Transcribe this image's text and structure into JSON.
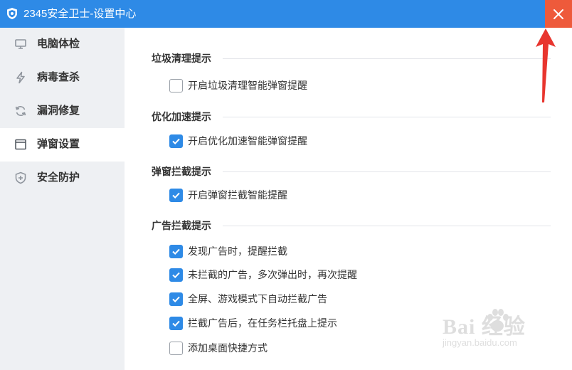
{
  "window": {
    "title": "2345安全卫士-设置中心",
    "close_label": "×"
  },
  "sidebar": {
    "items": [
      {
        "label": "电脑体检",
        "icon": "monitor-icon",
        "active": false
      },
      {
        "label": "病毒查杀",
        "icon": "lightning-icon",
        "active": false
      },
      {
        "label": "漏洞修复",
        "icon": "refresh-icon",
        "active": false
      },
      {
        "label": "弹窗设置",
        "icon": "window-icon",
        "active": true
      },
      {
        "label": "安全防护",
        "icon": "shield-plus-icon",
        "active": false
      }
    ]
  },
  "sections": [
    {
      "title": "垃圾清理提示",
      "options": [
        {
          "label": "开启垃圾清理智能弹窗提醒",
          "checked": false
        }
      ]
    },
    {
      "title": "优化加速提示",
      "options": [
        {
          "label": "开启优化加速智能弹窗提醒",
          "checked": true
        }
      ]
    },
    {
      "title": "弹窗拦截提示",
      "options": [
        {
          "label": "开启弹窗拦截智能提醒",
          "checked": true
        }
      ]
    },
    {
      "title": "广告拦截提示",
      "options": [
        {
          "label": "发现广告时，提醒拦截",
          "checked": true
        },
        {
          "label": "未拦截的广告，多次弹出时，再次提醒",
          "checked": true
        },
        {
          "label": "全屏、游戏模式下自动拦截广告",
          "checked": true
        },
        {
          "label": "拦截广告后，在任务栏托盘上提示",
          "checked": true
        },
        {
          "label": "添加桌面快捷方式",
          "checked": false
        }
      ]
    }
  ],
  "watermark": {
    "logo": "Bai 经验",
    "url": "jingyan.baidu.com"
  },
  "colors": {
    "titlebar": "#2e8ae6",
    "close_button": "#ee5a3b",
    "checkbox_on": "#2e8ae6",
    "annotation_arrow": "#e8352e",
    "sidebar_bg": "#eef0f3"
  }
}
